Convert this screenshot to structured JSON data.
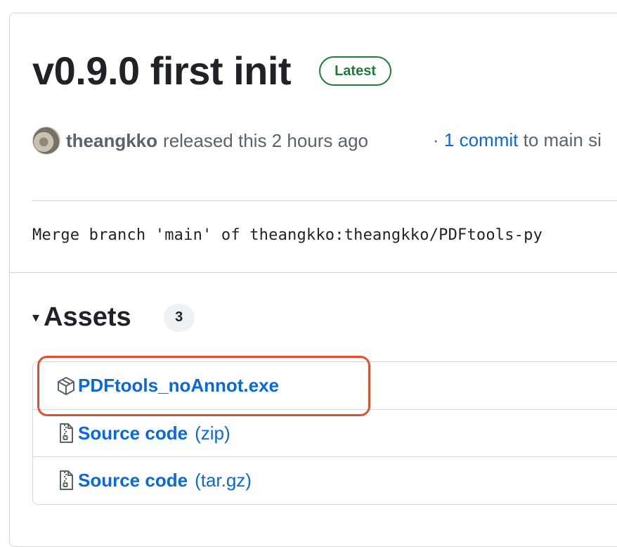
{
  "release": {
    "title": "v0.9.0 first init",
    "badge": "Latest",
    "author": "theangkko",
    "released_text": "released this 2 hours ago",
    "separator": "·",
    "commit_link": "1 commit",
    "commit_suffix": "to main si",
    "commit_message": "Merge branch 'main' of theangkko:theangkko/PDFtools-py"
  },
  "assets": {
    "caret": "▾",
    "title": "Assets",
    "count": "3",
    "items": [
      {
        "icon": "package-icon",
        "name": "PDFtools_noAnnot.exe",
        "suffix": ""
      },
      {
        "icon": "file-zip-icon",
        "name": "Source code",
        "suffix": "(zip)"
      },
      {
        "icon": "file-zip-icon",
        "name": "Source code",
        "suffix": "(tar.gz)"
      }
    ]
  },
  "colors": {
    "link": "#0969da",
    "latest_green": "#1a7f37",
    "highlight_red": "#e34f2c",
    "muted": "#59636e"
  }
}
